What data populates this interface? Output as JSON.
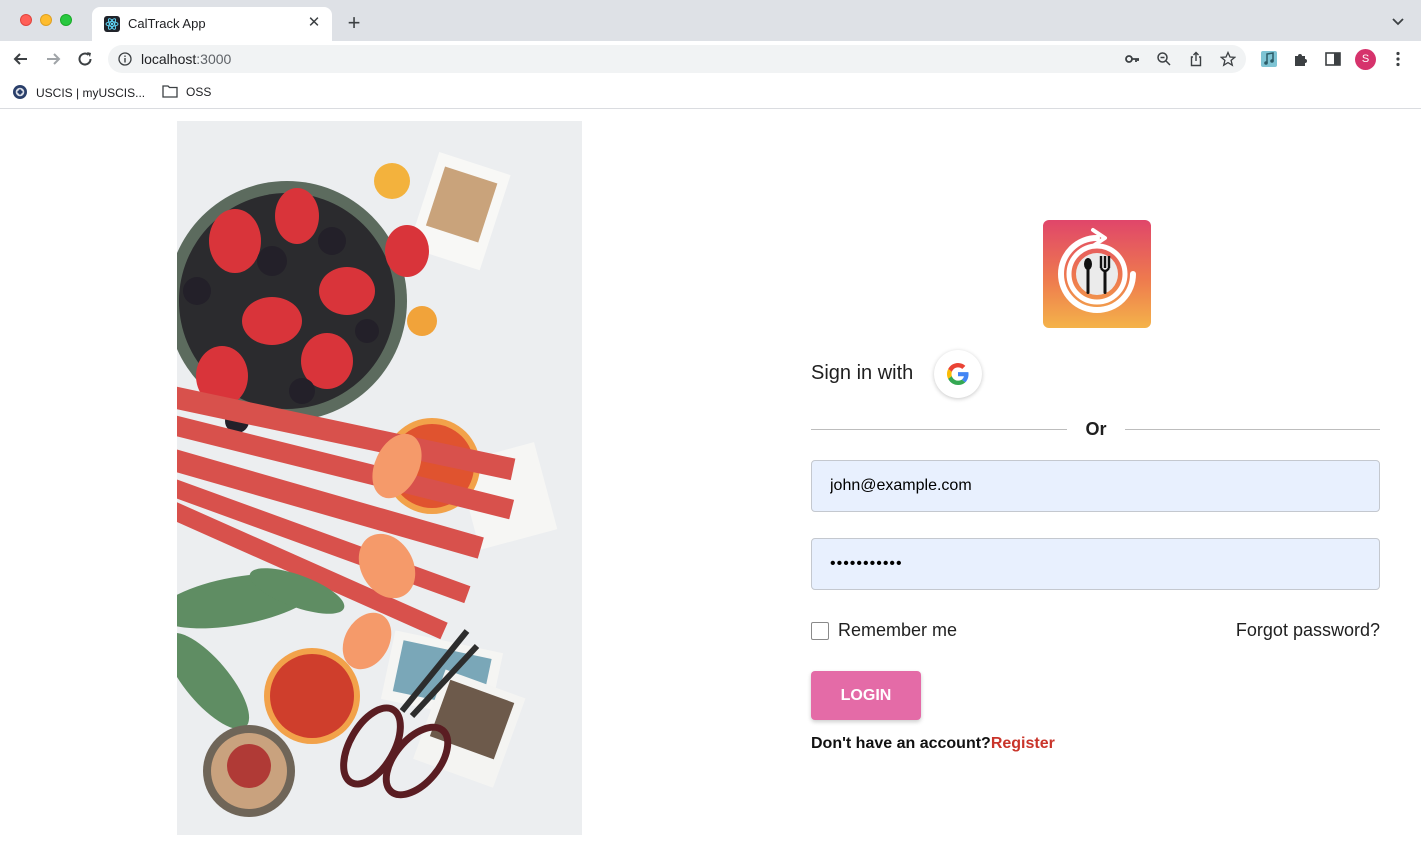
{
  "browser": {
    "tab_title": "CalTrack App",
    "tab_close": "✕",
    "new_tab": "+",
    "url_host": "localhost",
    "url_port": ":3000",
    "avatar_initial": "S",
    "bookmarks": [
      {
        "label": "USCIS | myUSCIS...",
        "icon": "uscis-seal-icon"
      },
      {
        "label": "OSS",
        "icon": "folder-icon"
      }
    ]
  },
  "login": {
    "signin_with": "Sign in with",
    "or": "Or",
    "email_value": "john@example.com",
    "password_masked": "•••••••••••",
    "remember_me": "Remember me",
    "forgot_password": "Forgot password?",
    "login_button": "LOGIN",
    "no_account": "Don't have an account?",
    "register": "Register"
  },
  "colors": {
    "accent": "#e46ba7",
    "register_link": "#c9342a",
    "input_bg": "#e8f0fe",
    "logo_gradient_top": "#e0466a",
    "logo_gradient_bottom": "#f4b34a"
  }
}
